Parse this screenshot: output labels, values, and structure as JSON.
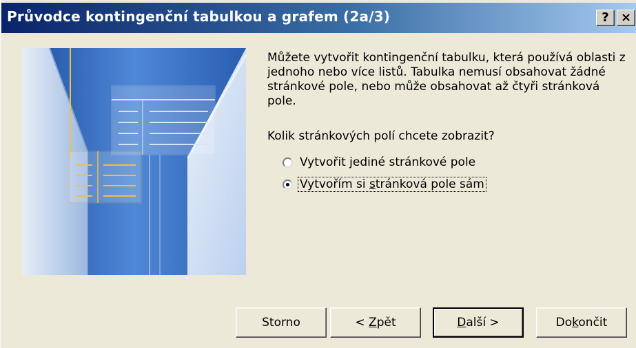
{
  "window": {
    "title": "Průvodce kontingenční tabulkou a grafem (2a/3)",
    "help_glyph": "?",
    "close_glyph": "×"
  },
  "content": {
    "prompt": "Můžete vytvořit kontingenční tabulku, která používá oblasti z jednoho nebo více listů. Tabulka nemusí obsahovat žádné stránkové pole, nebo může obsahovat až čtyři stránková pole.",
    "question": "Kolik stránkových polí chcete zobrazit?",
    "options": [
      {
        "pre": "Vytvořit ",
        "mnemonic": "j",
        "post": "ediné stránkové pole",
        "selected": false
      },
      {
        "pre": "Vytvořím si ",
        "mnemonic": "s",
        "post": "tránková pole sám",
        "selected": true
      }
    ]
  },
  "buttons": {
    "cancel": {
      "label": "Storno"
    },
    "back": {
      "pre": "< ",
      "mnemonic": "Z",
      "post": "pět"
    },
    "next": {
      "pre": "",
      "mnemonic": "D",
      "post": "alší >"
    },
    "finish": {
      "pre": "Do",
      "mnemonic": "k",
      "post": "ončit"
    }
  },
  "colors": {
    "title_start": "#0a246a",
    "title_end": "#a6caf0",
    "art_blue": "#2d62b4",
    "art_yellow": "#f0c040",
    "dialog_bg": "#ece9d8"
  }
}
